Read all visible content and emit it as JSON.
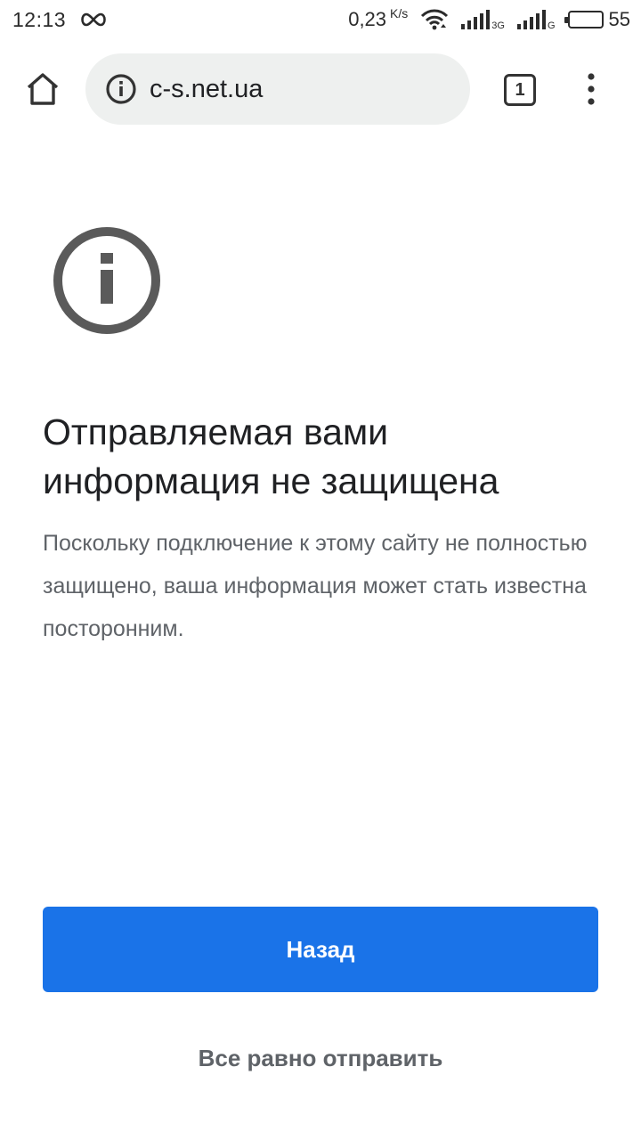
{
  "status_bar": {
    "time": "12:13",
    "net_speed": "0,23",
    "net_speed_unit": "K/s",
    "sim1_tag": "3G",
    "sim2_tag": "G",
    "battery_level": "55",
    "battery_fraction": 0.55,
    "icons": [
      "infinity-icon",
      "wifi-icon",
      "signal-icon",
      "battery-icon"
    ]
  },
  "toolbar": {
    "url": "c-s.net.ua",
    "tab_count": "1",
    "icons": [
      "home-icon",
      "info-icon",
      "tabs-icon",
      "menu-icon"
    ]
  },
  "warning": {
    "icon": "info-icon",
    "title": "Отправляемая вами информация не защищена",
    "description": "Поскольку подключение к этому сайту не полностью защищено, ваша информация может стать известна посторонним."
  },
  "actions": {
    "back_label": "Назад",
    "send_anyway_label": "Все равно отправить"
  },
  "colors": {
    "primary": "#1a73e8",
    "omnibox_bg": "#eef0ef",
    "text": "#202124",
    "secondary_text": "#5f6368"
  }
}
